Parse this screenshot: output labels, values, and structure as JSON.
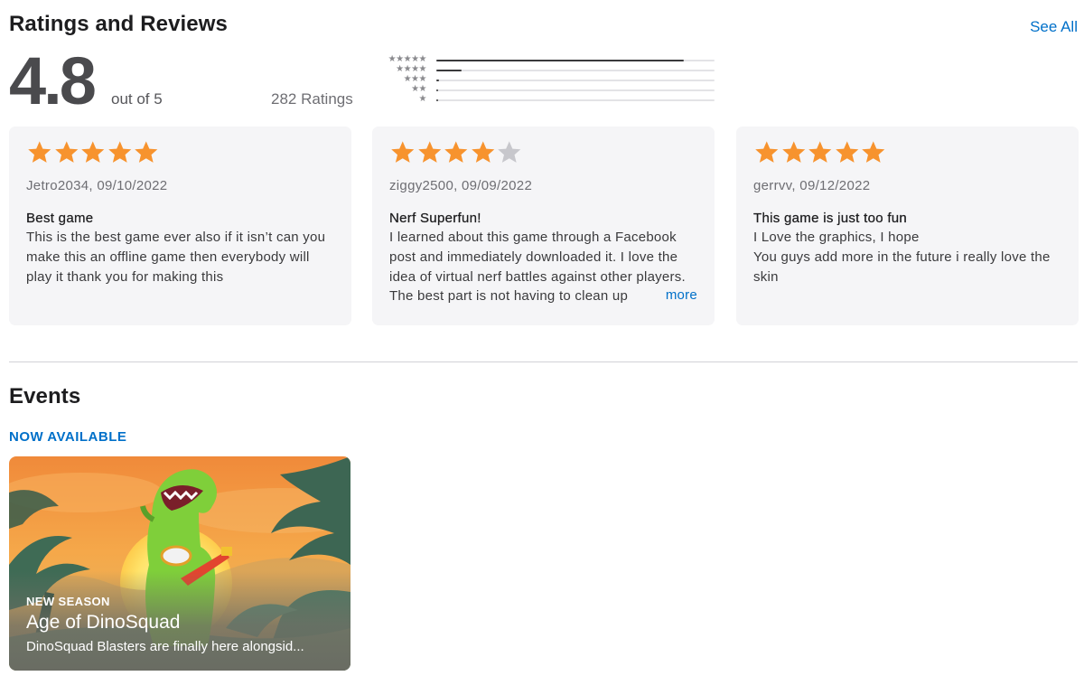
{
  "ratings": {
    "title": "Ratings and Reviews",
    "see_all_label": "See All",
    "score": "4.8",
    "out_of": "out of 5",
    "count_label": "282 Ratings",
    "histogram": [
      {
        "stars": 5,
        "fraction": 0.89
      },
      {
        "stars": 4,
        "fraction": 0.09
      },
      {
        "stars": 3,
        "fraction": 0.01
      },
      {
        "stars": 2,
        "fraction": 0.005
      },
      {
        "stars": 1,
        "fraction": 0.005
      }
    ]
  },
  "reviews": [
    {
      "rating": 5,
      "author": "Jetro2034, 09/10/2022",
      "title": "Best game",
      "body": "This is the best game ever also if it isn’t can you make this an offline game then everybody will play it thank you for making this",
      "truncated": false
    },
    {
      "rating": 4,
      "author": "ziggy2500, 09/09/2022",
      "title": "Nerf Superfun!",
      "body": "I learned about this game through a Facebook post and immediately downloaded it. I love the idea of virtual nerf battles against other players. The best part is not having to clean up",
      "truncated": true,
      "more_label": "more"
    },
    {
      "rating": 5,
      "author": "gerrvv, 09/12/2022",
      "title": "This game is just too fun",
      "body": "I Love the graphics, I hope\nYou guys add more in the future i really love the skin",
      "truncated": false
    }
  ],
  "events": {
    "title": "Events",
    "status": "NOW AVAILABLE",
    "card": {
      "badge": "NEW SEASON",
      "title": "Age of DinoSquad",
      "description": "DinoSquad Blasters are finally here alongsid..."
    }
  },
  "colors": {
    "star_filled": "#f7932e",
    "star_empty": "#c7c7cc",
    "link": "#0070c9",
    "card_bg": "#f5f5f7"
  }
}
